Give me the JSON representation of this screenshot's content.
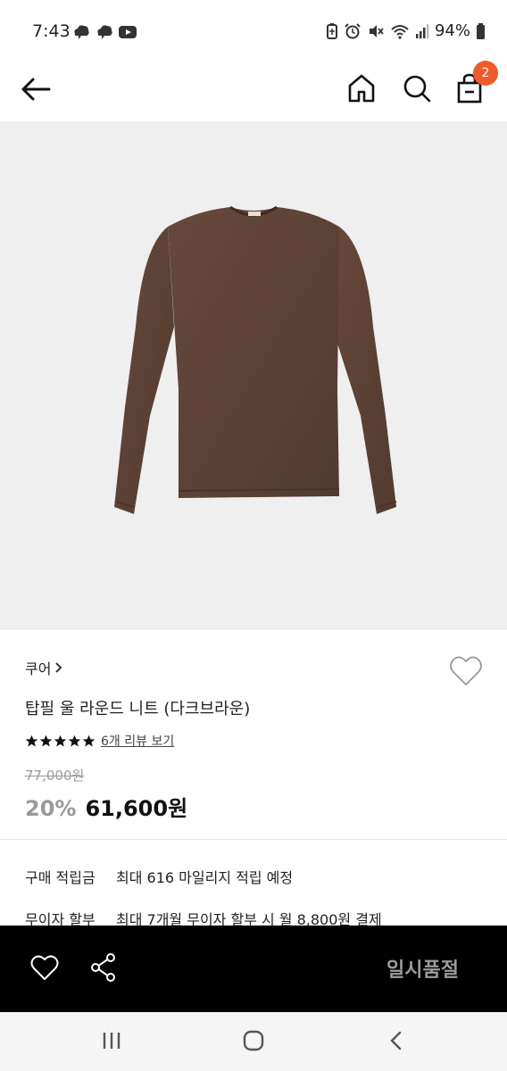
{
  "status": {
    "time": "7:43",
    "battery": "94%",
    "left_icons": [
      "cloud-icon",
      "cloud-icon",
      "youtube-icon"
    ],
    "right_icons": [
      "battery-saver-icon",
      "alarm-icon",
      "mute-icon",
      "wifi-icon",
      "signal-icon",
      "battery-icon"
    ]
  },
  "header": {
    "cart_count": "2",
    "accent_color": "#f05a28"
  },
  "product": {
    "brand": "쿠어",
    "name": "탑필 울 라운드 니트 (다크브라운)",
    "review_link": "6개 리뷰 보기",
    "rating_stars": 5,
    "original_price": "77,000원",
    "discount": "20%",
    "sale_price": "61,600원",
    "image_color": "#5b3f33"
  },
  "benefits": [
    {
      "label": "구매 적립금",
      "value": "최대 616 마일리지 적립 예정"
    },
    {
      "label": "무이자 할부",
      "value": "최대 7개월 무이자 할부 시 월 8,800원 결제"
    }
  ],
  "action_bar": {
    "status_label": "일시품절"
  }
}
